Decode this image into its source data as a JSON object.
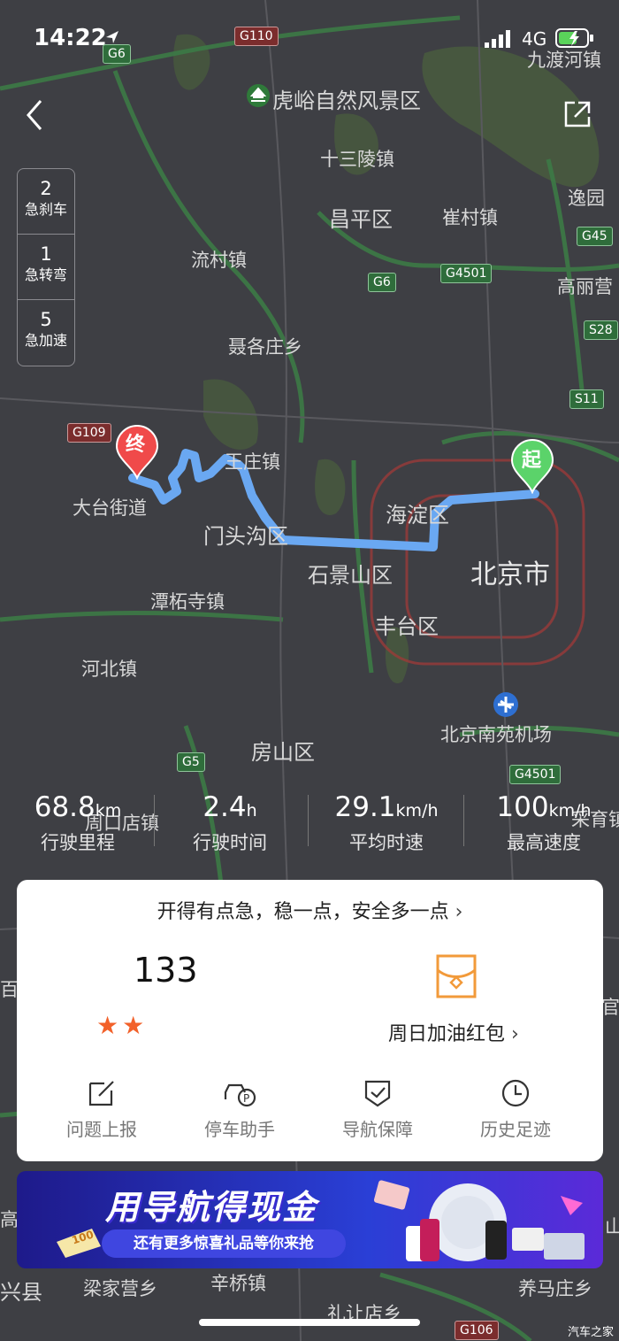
{
  "status_bar": {
    "time": "14:22",
    "network": "4G"
  },
  "map": {
    "places": {
      "yukou": "虎峪自然风景区",
      "jiudu": "九渡河镇",
      "shisanling": "十三陵镇",
      "changping": "昌平区",
      "cuicun": "崔村镇",
      "yiyuan": "逸园",
      "liucun": "流村镇",
      "gaoliying": "高丽营",
      "niegezhuang": "聂各庄乡",
      "wangzhuang": "王庄镇",
      "datai": "大台街道",
      "mentougou": "门头沟区",
      "haidian": "海淀区",
      "shijingshan": "石景山区",
      "beijing": "北京市",
      "tanzhesi": "潭柘寺镇",
      "fengtai": "丰台区",
      "hebei": "河北镇",
      "fangshan": "房山区",
      "nanyuan": "北京南苑机场",
      "zhoukoudian": "周口店镇",
      "caiyu": "采育镇",
      "liangjiaying": "梁家营乡",
      "xinqiao": "辛桥镇",
      "yangma": "养马庄乡",
      "lirang": "礼让店乡",
      "gao": "高",
      "xing": "兴县",
      "bai": "百",
      "guan": "官",
      "shan": "山"
    },
    "highways": {
      "g6a": "G6",
      "g110": "G110",
      "g6b": "G6",
      "g4501a": "G4501",
      "g45": "G45",
      "s28": "S28",
      "s11": "S11",
      "g109": "G109",
      "g5": "G5",
      "g4501b": "G4501",
      "g106": "G106"
    },
    "start_marker": "起",
    "end_marker": "终"
  },
  "events": [
    {
      "count": "2",
      "label": "急刹车"
    },
    {
      "count": "1",
      "label": "急转弯"
    },
    {
      "count": "5",
      "label": "急加速"
    }
  ],
  "stats": [
    {
      "value": "68.8",
      "unit": "km",
      "label": "行驶里程"
    },
    {
      "value": "2.4",
      "unit": "h",
      "label": "行驶时间"
    },
    {
      "value": "29.1",
      "unit": "km/h",
      "label": "平均时速"
    },
    {
      "value": "100",
      "unit": "km/h",
      "label": "最高速度"
    }
  ],
  "card": {
    "tip": "开得有点急，稳一点，安全多一点",
    "score": "133",
    "stars": 2,
    "redpack": "周日加油红包",
    "tools": [
      {
        "label": "问题上报",
        "icon": "edit-icon"
      },
      {
        "label": "停车助手",
        "icon": "parking-car-icon"
      },
      {
        "label": "导航保障",
        "icon": "shield-check-icon"
      },
      {
        "label": "历史足迹",
        "icon": "clock-icon"
      }
    ]
  },
  "banner": {
    "title": "用导航得现金",
    "subtitle": "还有更多惊喜礼品等你来抢",
    "coupon": "100"
  },
  "watermark": "汽车之家"
}
